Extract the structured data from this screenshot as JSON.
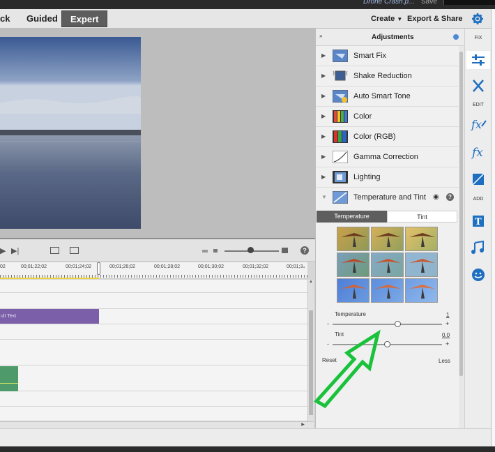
{
  "title_strip": {
    "file_name": "Drone Crash.p...",
    "save_label": "Save"
  },
  "mode_tabs": [
    {
      "label": "ck"
    },
    {
      "label": "Guided"
    },
    {
      "label": "Expert"
    }
  ],
  "menus": {
    "create": "Create",
    "export_share": "Export & Share"
  },
  "timeline": {
    "timecodes": [
      "02",
      "00;01;22;02",
      "00;01;24;02",
      "00;01;26;02",
      "00;01;28;02",
      "00;01;30;02",
      "00;01;32;02",
      "00;01;3₄"
    ],
    "text_clip_label": "ult Text"
  },
  "adjustments": {
    "title": "Adjustments",
    "items": [
      {
        "label": "Smart Fix",
        "icon": "smart-fix-icon"
      },
      {
        "label": "Shake Reduction",
        "icon": "shake-reduction-icon"
      },
      {
        "label": "Auto Smart Tone",
        "icon": "auto-smart-tone-icon"
      },
      {
        "label": "Color",
        "icon": "color-icon"
      },
      {
        "label": "Color (RGB)",
        "icon": "color-rgb-icon"
      },
      {
        "label": "Gamma Correction",
        "icon": "gamma-correction-icon"
      },
      {
        "label": "Lighting",
        "icon": "lighting-icon"
      },
      {
        "label": "Temperature and Tint",
        "icon": "temperature-tint-icon"
      }
    ],
    "subtabs": {
      "temperature": "Temperature",
      "tint": "Tint"
    },
    "temperature": {
      "label": "Temperature",
      "value": "1",
      "level": 0.6,
      "minus": "-",
      "plus": "+"
    },
    "tint": {
      "label": "Tint",
      "value": "0.0",
      "level": 0.5,
      "minus": "-",
      "plus": "+"
    },
    "reset_label": "Reset",
    "less_label": "Less"
  },
  "toolbar": {
    "fix_label": "FIX",
    "edit_label": "EDIT",
    "add_label": "ADD"
  },
  "colors": {
    "accent": "#1f6fc1",
    "arrow": "#19c23a",
    "text_clip": "#7b5fa8",
    "green_clip": "#4f9a6a"
  }
}
